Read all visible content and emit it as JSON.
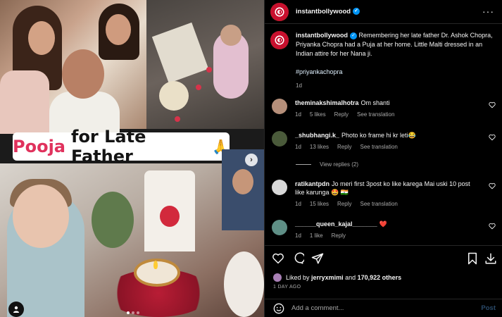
{
  "post": {
    "title_word_accent": "Pooja",
    "title_word_rest": "for Late Father",
    "title_emoji": "🙏"
  },
  "header": {
    "username": "instantbollywood",
    "more_icon": "more-horizontal-icon"
  },
  "caption": {
    "username": "instantbollywood",
    "text": "Remembering her late father Dr. Ashok Chopra, Priyanka Chopra had a Puja at her home. Little Malti dressed in an Indian attire for her Nana ji.",
    "hashtag": "#priyankachopra",
    "time": "1d"
  },
  "comments": [
    {
      "username": "theminakshimalhotra",
      "text": "Om shanti",
      "time": "1d",
      "likes": "5 likes",
      "reply": "Reply",
      "translate": "See translation",
      "avatar_color": "#b58f7a"
    },
    {
      "username": "_shubhangi.k_",
      "text": "Photo ko frame hi kr leti😂",
      "time": "1d",
      "likes": "13 likes",
      "reply": "Reply",
      "translate": "See translation",
      "avatar_color": "#4a5a3a"
    },
    {
      "username": "ratikantpdn",
      "text": "Jo meri first 3post ko like karega Mai uski 10 post like karunga 🤩 🇮🇳",
      "time": "1d",
      "likes": "15 likes",
      "reply": "Reply",
      "translate": "See translation",
      "avatar_color": "#d8d8d8"
    },
    {
      "username": "______queen_kajal_______",
      "text": "❤️",
      "time": "1d",
      "likes": "1 like",
      "reply": "Reply",
      "avatar_color": "#5f8f86"
    }
  ],
  "view_replies": "View replies (2)",
  "likes": {
    "prefix": "Liked by",
    "user": "jerryxmimi",
    "middle": "and",
    "count": "170,922 others"
  },
  "posted_ago": "1 DAY AGO",
  "add_comment": {
    "placeholder": "Add a comment...",
    "post_label": "Post"
  },
  "colors": {
    "background": "#000000",
    "accent_title": "#e0325d",
    "verified": "#0095f6",
    "heart_red": "#e0245e",
    "muted": "#a8a8a8"
  }
}
